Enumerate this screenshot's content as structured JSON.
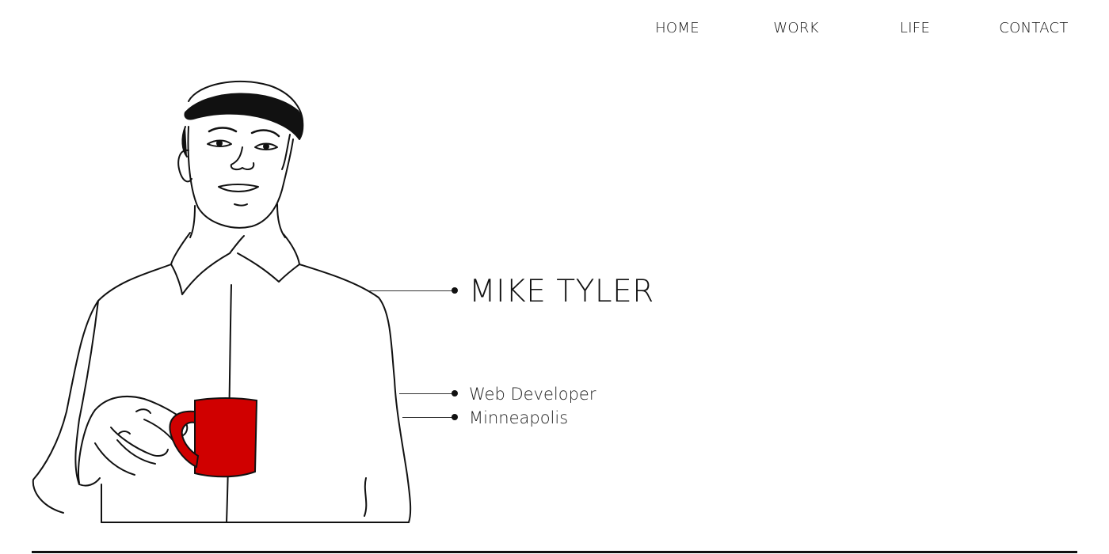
{
  "nav": {
    "items": [
      {
        "label": "HOME"
      },
      {
        "label": "WORK"
      },
      {
        "label": "LIFE"
      },
      {
        "label": "CONTACT"
      }
    ]
  },
  "profile": {
    "name": "MIKE TYLER",
    "role": "Web Developer",
    "location": "Minneapolis"
  },
  "colors": {
    "mug": "#d00000",
    "line": "#111111",
    "background": "#ffffff"
  }
}
